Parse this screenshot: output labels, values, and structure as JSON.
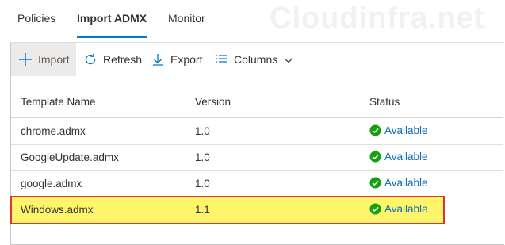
{
  "tabs": [
    {
      "label": "Policies"
    },
    {
      "label": "Import ADMX"
    },
    {
      "label": "Monitor"
    }
  ],
  "active_tab": "Import ADMX",
  "watermark": "Cloudinfra.net",
  "toolbar": {
    "import_label": "Import",
    "refresh_label": "Refresh",
    "export_label": "Export",
    "columns_label": "Columns"
  },
  "table": {
    "headers": {
      "name": "Template Name",
      "version": "Version",
      "status": "Status"
    },
    "rows": [
      {
        "name": "chrome.admx",
        "version": "1.0",
        "status": "Available"
      },
      {
        "name": "GoogleUpdate.admx",
        "version": "1.0",
        "status": "Available"
      },
      {
        "name": "google.admx",
        "version": "1.0",
        "status": "Available"
      },
      {
        "name": "Windows.admx",
        "version": "1.1",
        "status": "Available"
      }
    ],
    "highlighted_row": "Windows.admx"
  },
  "colors": {
    "accent": "#0078d4",
    "status_green": "#13a10e",
    "highlight": "#fff56a",
    "highlight_border": "#e0332e"
  }
}
